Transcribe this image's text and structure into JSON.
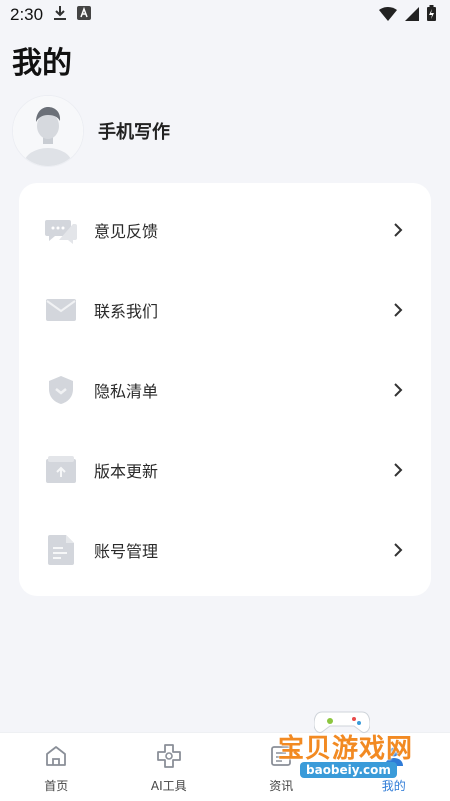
{
  "status_bar": {
    "time": "2:30"
  },
  "page": {
    "title": "我的"
  },
  "profile": {
    "name": "手机写作"
  },
  "menu": {
    "items": [
      {
        "label": "意见反馈",
        "icon": "chat-bubbles-icon"
      },
      {
        "label": "联系我们",
        "icon": "mail-icon"
      },
      {
        "label": "隐私清单",
        "icon": "shield-icon"
      },
      {
        "label": "版本更新",
        "icon": "upload-box-icon"
      },
      {
        "label": "账号管理",
        "icon": "document-icon"
      }
    ]
  },
  "bottom_nav": {
    "items": [
      {
        "label": "首页",
        "icon": "home-icon",
        "active": false
      },
      {
        "label": "AI工具",
        "icon": "ai-tools-icon",
        "active": false
      },
      {
        "label": "资讯",
        "icon": "news-icon",
        "active": false
      },
      {
        "label": "我的",
        "icon": "profile-icon",
        "active": true
      }
    ]
  },
  "watermark": {
    "text": "宝贝游戏网",
    "url": "baobeiy.com"
  },
  "colors": {
    "background": "#f4f5f9",
    "card": "#ffffff",
    "icon_gray": "#d3d6dc",
    "active_blue": "#2e7bd7"
  }
}
